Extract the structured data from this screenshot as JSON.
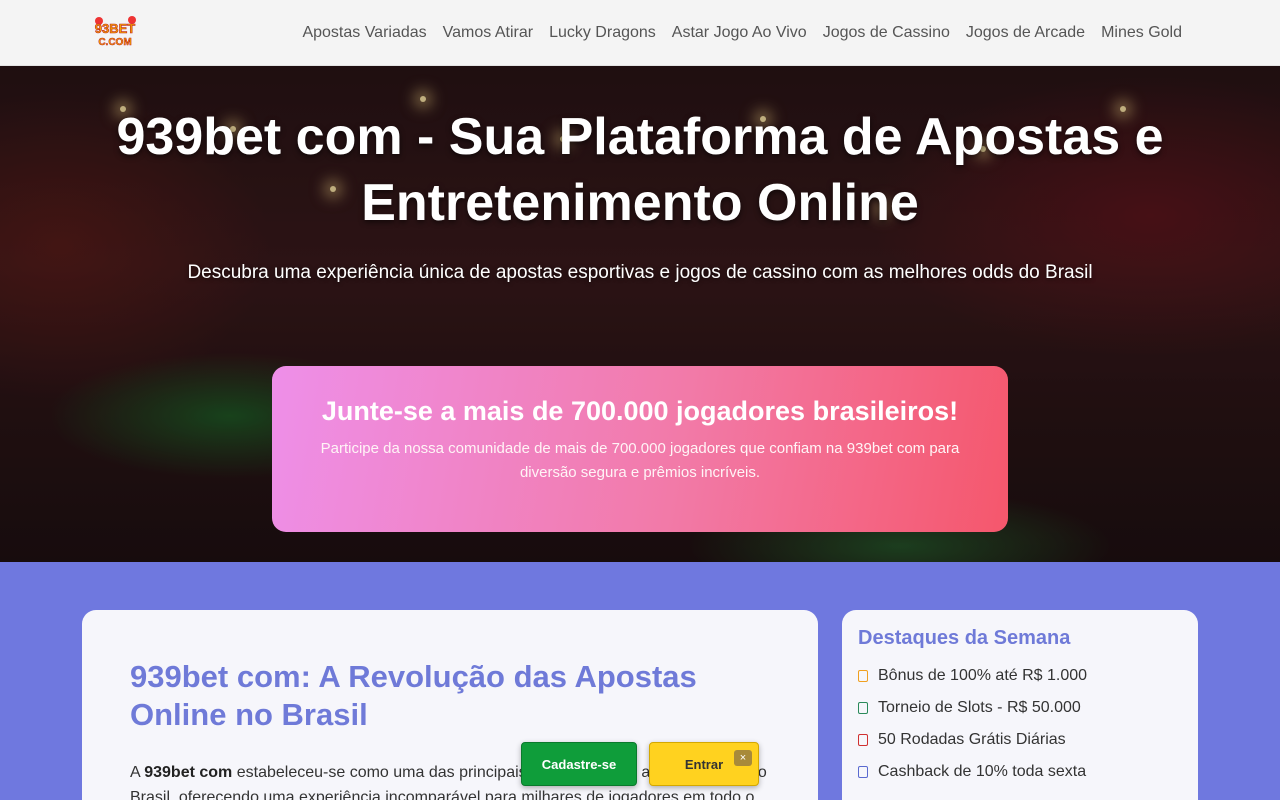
{
  "header": {
    "logo_text": "93BET C.COM",
    "nav": [
      "Apostas Variadas",
      "Vamos Atirar",
      "Lucky Dragons",
      "Astar Jogo Ao Vivo",
      "Jogos de Cassino",
      "Jogos de Arcade",
      "Mines Gold"
    ]
  },
  "hero": {
    "title": "939bet com - Sua Plataforma de Apostas e Entretenimento Online",
    "subtitle": "Descubra uma experiência única de apostas esportivas e jogos de cassino com as melhores odds do Brasil",
    "promo_title": "Junte-se a mais de 700.000 jogadores brasileiros!",
    "promo_text": "Participe da nossa comunidade de mais de 700.000 jogadores que confiam na 939bet com para diversão segura e prêmios incríveis."
  },
  "main": {
    "title": "939bet com: A Revolução das Apostas Online no Brasil",
    "text_prefix": "A ",
    "text_bold": "939bet com",
    "text_rest": " estabeleceu-se como uma das principais plataformas de apostas online do Brasil, oferecendo uma experiência incomparável para milhares de jogadores em todo o"
  },
  "sidebar": {
    "title": "Destaques da Semana",
    "items": [
      {
        "label": "Bônus de 100% até R$ 1.000",
        "color": "#f0a020"
      },
      {
        "label": "Torneio de Slots - R$ 50.000",
        "color": "#2a8a5a"
      },
      {
        "label": "50 Rodadas Grátis Diárias",
        "color": "#d03030"
      },
      {
        "label": "Cashback de 10% toda sexta",
        "color": "#5a6ad0"
      }
    ]
  },
  "floating": {
    "register_label": "Cadastre-se",
    "login_label": "Entrar",
    "close_label": "×"
  },
  "colors": {
    "accent": "#6f7ad8",
    "page_bg": "#6f78df",
    "register": "#0f9d3a",
    "login": "#ffd21f"
  }
}
